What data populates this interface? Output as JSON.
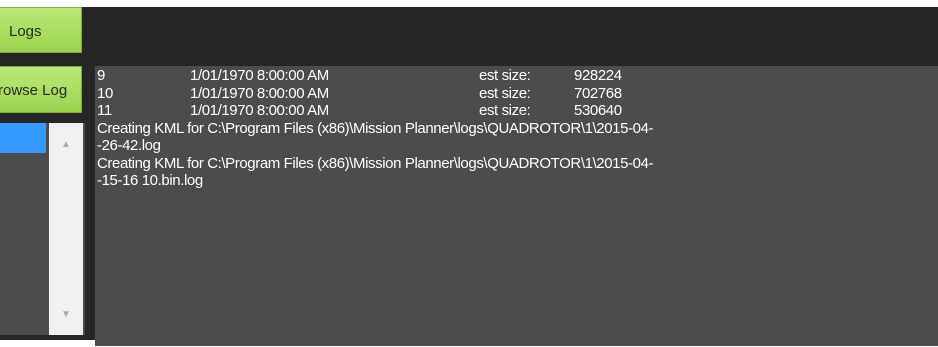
{
  "toolbar": {
    "logs_button": "Logs"
  },
  "sidebar": {
    "browse_button": "Browse Log",
    "scroll_up_glyph": "▲",
    "scroll_down_glyph": "▼"
  },
  "log_entries": [
    {
      "id": "9",
      "date": "1/01/1970 8:00:00 AM",
      "size_label": "est size:",
      "size": "928224"
    },
    {
      "id": "10",
      "date": "1/01/1970 8:00:00 AM",
      "size_label": "est size:",
      "size": "702768"
    },
    {
      "id": "11",
      "date": "1/01/1970 8:00:00 AM",
      "size_label": "est size:",
      "size": "530640"
    }
  ],
  "messages": [
    "Creating KML for C:\\Program Files (x86)\\Mission Planner\\logs\\QUADROTOR\\1\\2015-04-",
    "-26-42.log",
    "Creating KML for C:\\Program Files (x86)\\Mission Planner\\logs\\QUADROTOR\\1\\2015-04-",
    "-15-16 10.bin.log"
  ],
  "colors": {
    "button_green": "#9ad24c",
    "background_dark": "#262626",
    "log_background": "#4c4c4c",
    "selection_blue": "#3399ff"
  }
}
